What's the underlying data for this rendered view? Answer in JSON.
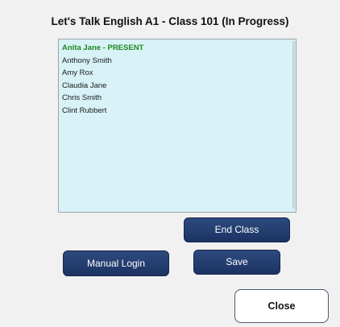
{
  "class_title": "Let's Talk English A1 - Class 101 (In Progress)",
  "students": [
    {
      "label": "Anita Jane - PRESENT",
      "status": "present"
    },
    {
      "label": "Anthony Smith",
      "status": ""
    },
    {
      "label": "Amy Rox",
      "status": ""
    },
    {
      "label": "Claudia Jane",
      "status": ""
    },
    {
      "label": "Chris Smith",
      "status": ""
    },
    {
      "label": "Clint Rubbert",
      "status": ""
    }
  ],
  "buttons": {
    "end_class": "End Class",
    "manual_login": "Manual Login",
    "save": "Save",
    "close": "Close"
  },
  "colors": {
    "panel_background": "#f1f1f1",
    "list_background": "#d8f2f7",
    "present_text": "#1f8a1f",
    "button_primary": "#1f3766"
  }
}
